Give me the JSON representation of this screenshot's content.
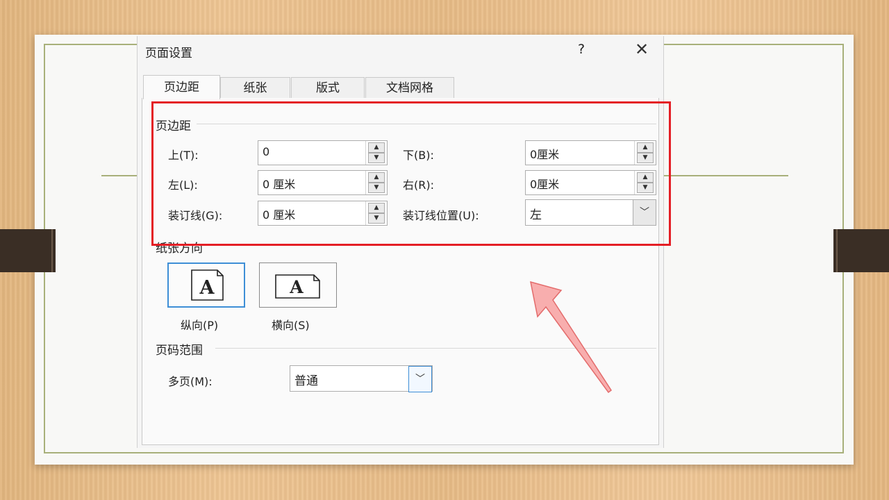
{
  "dialog": {
    "title": "页面设置",
    "help_label": "?",
    "close_label": "✕",
    "tabs": [
      {
        "label": "页边距",
        "active": true
      },
      {
        "label": "纸张",
        "active": false
      },
      {
        "label": "版式",
        "active": false
      },
      {
        "label": "文档网格",
        "active": false
      }
    ]
  },
  "margins": {
    "section_title": "页边距",
    "top": {
      "label": "上(T):",
      "value": "0"
    },
    "bottom": {
      "label": "下(B):",
      "value": "0厘米"
    },
    "left": {
      "label": "左(L):",
      "value": "0 厘米"
    },
    "right": {
      "label": "右(R):",
      "value": "0厘米"
    },
    "gutter": {
      "label": "装订线(G):",
      "value": "0 厘米"
    },
    "gutter_position": {
      "label": "装订线位置(U):",
      "value": "左"
    }
  },
  "orientation": {
    "section_title": "纸张方向",
    "portrait_label": "纵向(P)",
    "landscape_label": "横向(S)",
    "icon_glyph": "A",
    "selected": "portrait"
  },
  "pages": {
    "section_title": "页码范围",
    "multiple_label": "多页(M):",
    "multiple_value": "普通"
  },
  "colors": {
    "highlight": "#e41e25",
    "arrow": "#f7a0a0",
    "accent_blue": "#3d8ed6"
  }
}
